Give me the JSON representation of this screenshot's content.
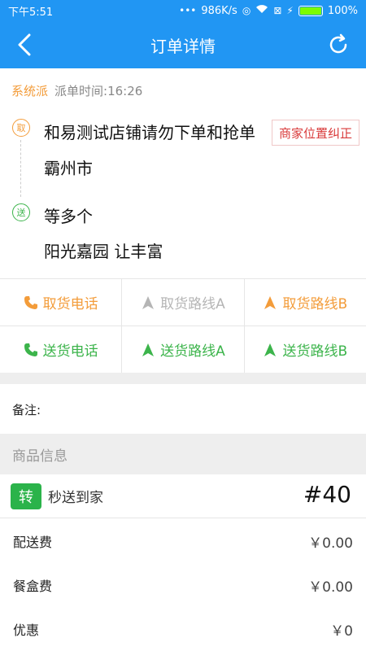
{
  "status_bar": {
    "time": "下午5:51",
    "speed": "986K/s",
    "battery": "100%",
    "battery_level": 1.0
  },
  "header": {
    "title": "订单详情"
  },
  "dispatch": {
    "type": "系统派",
    "time_label": "派单时间:16:26"
  },
  "pickup": {
    "pin": "取",
    "name": "和易测试店铺请勿下单和抢单",
    "city": "霸州市",
    "correct_label": "商家位置纠正"
  },
  "dropoff": {
    "pin": "送",
    "name": "等多个",
    "address": "阳光嘉园 让丰富"
  },
  "actions": {
    "pickup_phone": "取货电话",
    "pickup_route_a": "取货路线A",
    "pickup_route_b": "取货路线B",
    "delivery_phone": "送货电话",
    "delivery_route_a": "送货路线A",
    "delivery_route_b": "送货路线B"
  },
  "remark_label": "备注:",
  "goods": {
    "section_title": "商品信息",
    "badge": "转",
    "name": "秒送到家",
    "order_no": "#40"
  },
  "fees": [
    {
      "label": "配送费",
      "value": "￥0.00"
    },
    {
      "label": "餐盒费",
      "value": "￥0.00"
    },
    {
      "label": "优惠",
      "value": "￥0"
    }
  ],
  "colors": {
    "primary": "#2196F3",
    "orange": "#F39C3A",
    "green": "#3CB44B",
    "red": "#D93A3A",
    "gray": "#B5B5B5"
  }
}
